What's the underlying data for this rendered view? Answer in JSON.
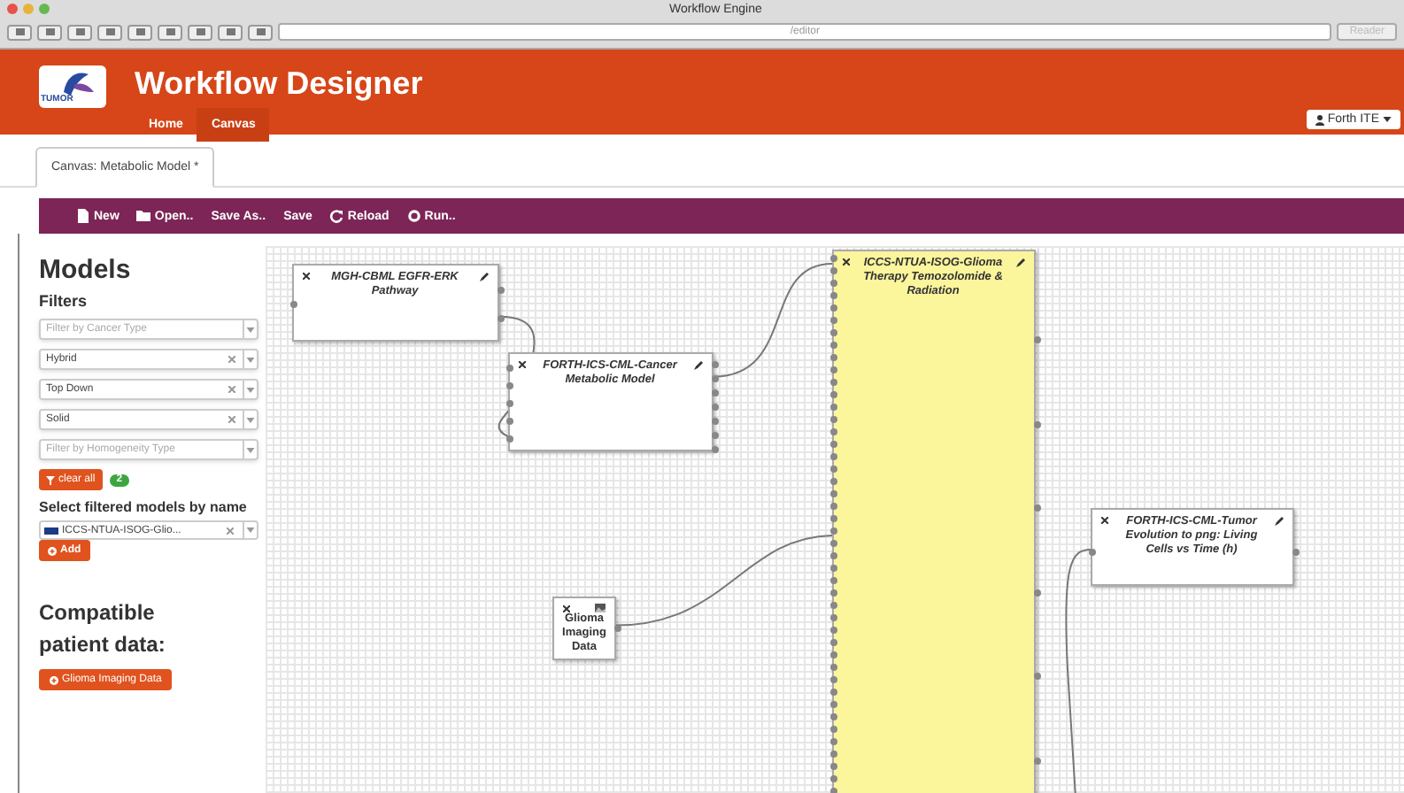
{
  "window": {
    "title": "Workflow Engine",
    "address": "/editor",
    "reader": "Reader"
  },
  "header": {
    "title": "Workflow Designer",
    "logo_text": "TUMOR",
    "nav": [
      {
        "label": "Home",
        "selected": false
      },
      {
        "label": "Canvas",
        "selected": true
      }
    ],
    "user": "Forth ITE"
  },
  "tabs": [
    {
      "label": "Canvas: Metabolic Model *",
      "selected": true
    }
  ],
  "toolbar": [
    {
      "label": "New"
    },
    {
      "label": "Open.."
    },
    {
      "label": "Save As.."
    },
    {
      "label": "Save"
    },
    {
      "label": "Reload"
    },
    {
      "label": "Run.."
    }
  ],
  "sidebar": {
    "title": "Models",
    "filters_title": "Filters",
    "filters": [
      {
        "kind": "placeholder",
        "text": "Filter by Cancer Type"
      },
      {
        "kind": "value",
        "text": "Hybrid"
      },
      {
        "kind": "value",
        "text": "Top Down"
      },
      {
        "kind": "value",
        "text": "Solid"
      },
      {
        "kind": "placeholder",
        "text": "Filter by Homogeneity Type"
      }
    ],
    "clear_button": "clear all",
    "count": "2",
    "select_title": "Select filtered models by name",
    "selected_model": "ICCS-NTUA-ISOG-Glio...",
    "add_button": "Add",
    "compatible_title": "Compatible patient data:",
    "data_button": "Glioma Imaging Data"
  },
  "canvas": {
    "nodes": [
      {
        "kind": "model",
        "title": "MGH-CBML EGFR-ERK Pathway",
        "selected": false
      },
      {
        "kind": "model",
        "title": "FORTH-ICS-CML-Cancer Metabolic Model",
        "selected": false
      },
      {
        "kind": "model",
        "title": "ICCS-NTUA-ISOG-Glioma Therapy Temozolomide & Radiation",
        "selected": true
      },
      {
        "kind": "model",
        "title": "FORTH-ICS-CML-Tumor Evolution to png: Living Cells vs Time (h)",
        "selected": false
      },
      {
        "kind": "data",
        "title": "Glioma Imaging Data",
        "selected": false
      }
    ]
  }
}
